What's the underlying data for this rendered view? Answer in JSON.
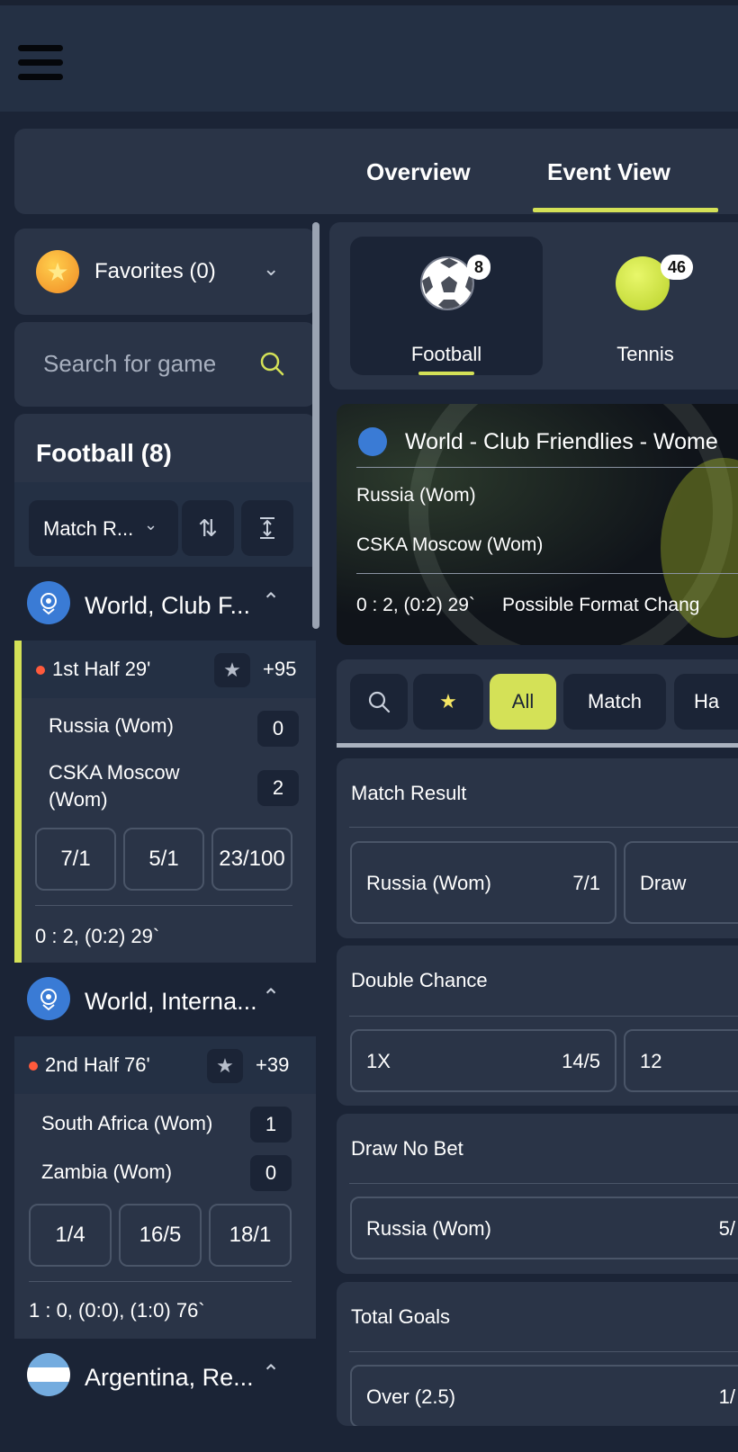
{
  "tabs": [
    {
      "label": "Overview"
    },
    {
      "label": "Event View"
    }
  ],
  "favorites": {
    "label": "Favorites (0)"
  },
  "search": {
    "placeholder": "Search for game"
  },
  "sport_section": {
    "title": "Football (8)"
  },
  "filter": {
    "select_value": "Match R..."
  },
  "leagues": [
    {
      "name": "World, Club F...",
      "match": {
        "status": "1st Half 29'",
        "more": "+95",
        "team1": "Russia (Wom)",
        "score1": "0",
        "team2": "CSKA Moscow (Wom)",
        "score2": "2",
        "odds": [
          "7/1",
          "5/1",
          "23/100"
        ],
        "result": "0 : 2, (0:2) 29`"
      }
    },
    {
      "name": "World, Interna...",
      "match": {
        "status": "2nd Half 76'",
        "more": "+39",
        "team1": "South Africa (Wom)",
        "score1": "1",
        "team2": "Zambia (Wom)",
        "score2": "0",
        "odds": [
          "1/4",
          "16/5",
          "18/1"
        ],
        "result": "1 : 0, (0:0), (1:0) 76`"
      }
    },
    {
      "name": "Argentina, Re..."
    }
  ],
  "sports": [
    {
      "label": "Football",
      "count": "8",
      "icon": "football-icon"
    },
    {
      "label": "Tennis",
      "count": "46",
      "icon": "tennis-ball-icon"
    }
  ],
  "event": {
    "title": "World - Club Friendlies - Wome",
    "team1": "Russia (Wom)",
    "team2": "CSKA Moscow (Wom)",
    "score": "0 : 2, (0:2) 29`",
    "note": "Possible Format Chang"
  },
  "market_filters": [
    {
      "label": "",
      "icon": "search-icon"
    },
    {
      "label": "",
      "icon": "star-icon"
    },
    {
      "label": "All"
    },
    {
      "label": "Match"
    },
    {
      "label": "Ha"
    }
  ],
  "markets": [
    {
      "title": "Match Result",
      "buttons": [
        {
          "label": "Russia (Wom)",
          "odd": "7/1"
        },
        {
          "label": "Draw",
          "odd": ""
        }
      ]
    },
    {
      "title": "Double Chance",
      "buttons": [
        {
          "label": "1X",
          "odd": "14/5"
        },
        {
          "label": "12",
          "odd": ""
        }
      ]
    },
    {
      "title": "Draw No Bet",
      "buttons": [
        {
          "label": "Russia (Wom)",
          "odd": "5/"
        }
      ]
    },
    {
      "title": "Total Goals",
      "buttons": [
        {
          "label": "Over (2.5)",
          "odd": "1/"
        }
      ]
    }
  ],
  "colors": {
    "accent": "#d4e157",
    "background": "#1b2436",
    "card": "#2a3447",
    "live": "#ff5a3c",
    "league": "#3a7bd5"
  }
}
